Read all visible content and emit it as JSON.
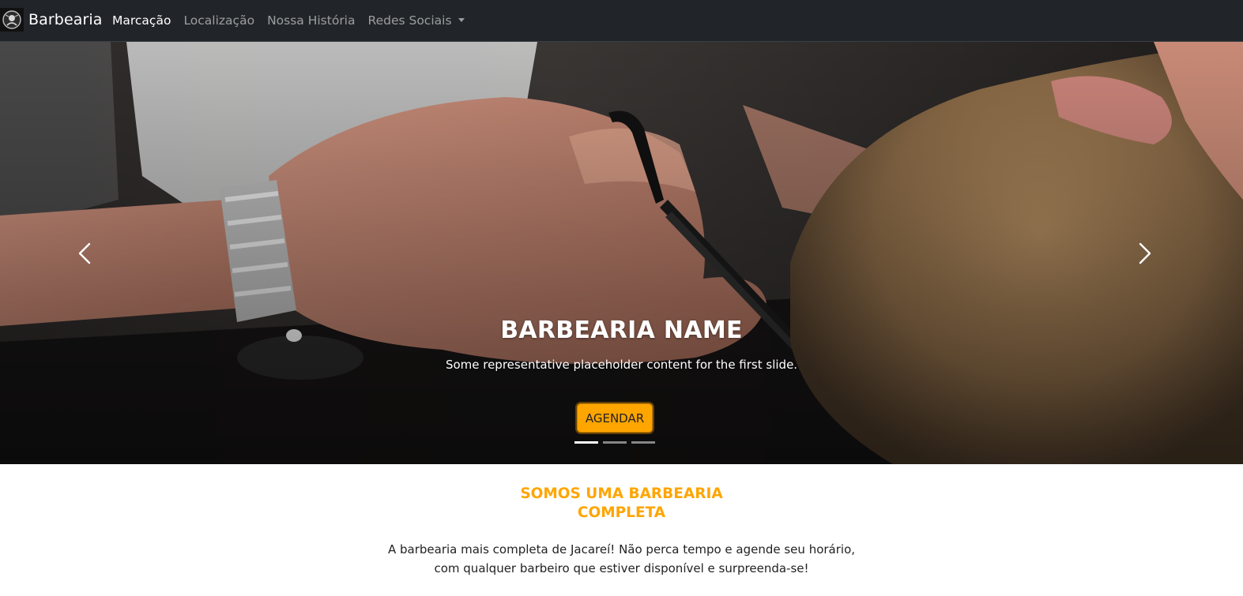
{
  "navbar": {
    "brand": "Barbearia",
    "links": [
      "Marcação",
      "Localização",
      "Nossa História",
      "Redes Sociais"
    ],
    "active_link": "Marcação"
  },
  "hero": {
    "title": "BARBEARIA NAME",
    "text": "Some representative placeholder content for the first slide.",
    "button_label": "AGENDAR",
    "slide_count": 3,
    "active_slide": 1
  },
  "about": {
    "title_line1": "SOMOS UMA BARBEARIA",
    "title_line2": "COMPLETA",
    "text_line1": "A barbearia mais completa de Jacareí! Não perca tempo e agende seu horário,",
    "text_line2": "com qualquer barbeiro que estiver disponível e surpreenda-se!"
  },
  "colors": {
    "navbar_bg": "#212529",
    "accent": "#ffa500",
    "nav_active": "#ffffff",
    "nav_inactive": "#8c8f92"
  },
  "icons": [
    "barber-logo-icon",
    "caret-down-icon",
    "chevron-left-icon",
    "chevron-right-icon"
  ]
}
